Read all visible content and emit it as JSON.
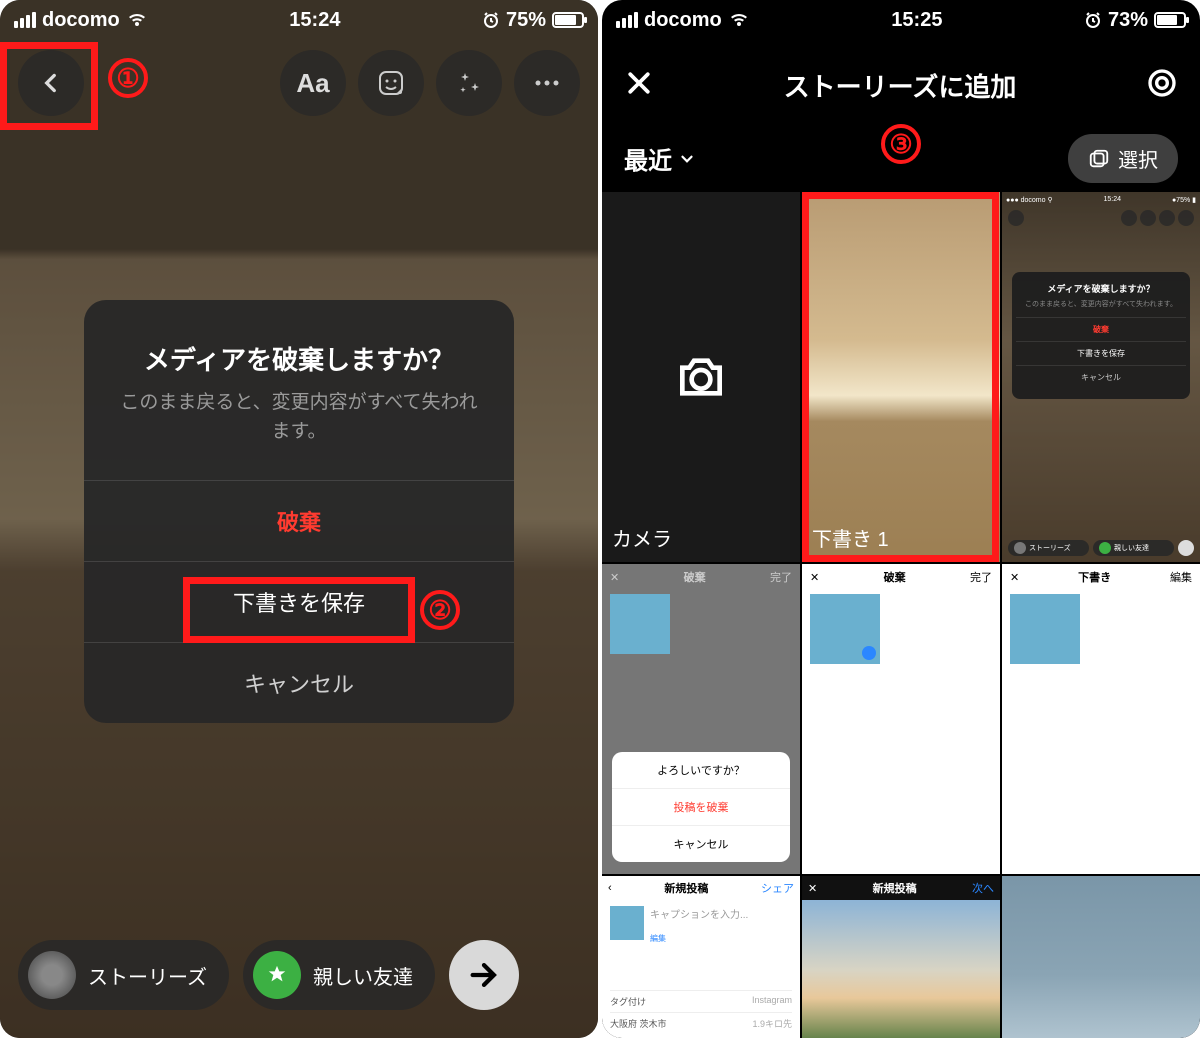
{
  "left": {
    "status": {
      "carrier": "docomo",
      "time": "15:24",
      "battery": "75%"
    },
    "tools": {
      "text": "Aa"
    },
    "dialog": {
      "title": "メディアを破棄しますか？",
      "subtitle": "このまま戻ると、変更内容がすべて失われます。",
      "discard": "破棄",
      "save": "下書きを保存",
      "cancel": "キャンセル"
    },
    "bottom": {
      "stories": "ストーリーズ",
      "friends": "親しい友達"
    },
    "annot": {
      "n1": "①",
      "n2": "②"
    }
  },
  "right": {
    "status": {
      "carrier": "docomo",
      "time": "15:25",
      "battery": "73%"
    },
    "header": {
      "title": "ストーリーズに追加"
    },
    "sub": {
      "recent": "最近",
      "select": "選択"
    },
    "annot": {
      "n3": "③"
    },
    "cells": {
      "camera": "カメラ",
      "draft": "下書き 1",
      "row2": {
        "a": {
          "l": "✕",
          "c": "破棄",
          "r": "完了",
          "sheet_q": "よろしいですか？",
          "sheet_d": "投稿を破棄",
          "sheet_c": "キャンセル"
        },
        "b": {
          "l": "✕",
          "c": "破棄",
          "r": "完了"
        },
        "c": {
          "l": "✕",
          "c": "下書き",
          "r": "編集"
        }
      },
      "row3": {
        "a": {
          "l": "‹",
          "c": "新規投稿",
          "r": "シェア",
          "cap": "キャプションを入力...",
          "edit": "編集",
          "tag": "タグ付け",
          "tagv": "Instagram",
          "loc": "大阪府 茨木市",
          "locv": "1.9キロ先"
        },
        "b": {
          "l": "✕",
          "c": "新規投稿",
          "r": "次へ"
        }
      }
    },
    "mini": {
      "t": "メディアを破棄しますか？",
      "s": "このまま戻ると、変更内容がすべて失われます。",
      "d": "破棄",
      "sv": "下書きを保存",
      "c": "キャンセル",
      "st": "ストーリーズ",
      "fr": "親しい友達"
    }
  }
}
